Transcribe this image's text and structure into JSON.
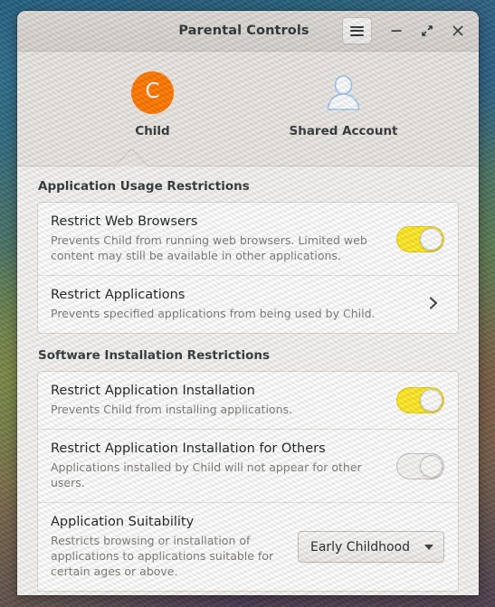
{
  "window": {
    "title": "Parental Controls",
    "menu_button_icon": "hamburger-menu-icon",
    "minimize_icon": "minimize-icon",
    "maximize_icon": "maximize-restore-icon",
    "close_icon": "close-icon"
  },
  "users": [
    {
      "label": "Child",
      "avatar_type": "letter",
      "avatar_letter": "C",
      "avatar_color": "#ff7800",
      "selected": true
    },
    {
      "label": "Shared Account",
      "avatar_type": "generic",
      "avatar_letter": "",
      "avatar_color": "#a8cdf0",
      "selected": false
    }
  ],
  "sections": [
    {
      "title": "Application Usage Restrictions",
      "rows": [
        {
          "title": "Restrict Web Browsers",
          "desc": "Prevents Child from running web browsers. Limited web content may still be available in other applications.",
          "control": "switch",
          "state": "on"
        },
        {
          "title": "Restrict Applications",
          "desc": "Prevents specified applications from being used by Child.",
          "control": "chevron",
          "state": ""
        }
      ]
    },
    {
      "title": "Software Installation Restrictions",
      "rows": [
        {
          "title": "Restrict Application Installation",
          "desc": "Prevents Child from installing applications.",
          "control": "switch",
          "state": "on"
        },
        {
          "title": "Restrict Application Installation for Others",
          "desc": "Applications installed by Child will not appear for other users.",
          "control": "switch",
          "state": "off"
        },
        {
          "title": "Application Suitability",
          "desc": "Restricts browsing or installation of applications to applications suitable for certain ages or above.",
          "control": "dropdown",
          "state": "",
          "dropdown_value": "Early Childhood"
        }
      ]
    }
  ],
  "colors": {
    "accent_avatar": "#ff7800",
    "switch_on": "#ffe926",
    "titlebar": "#d9d5d1",
    "panel": "#eae7e3"
  }
}
